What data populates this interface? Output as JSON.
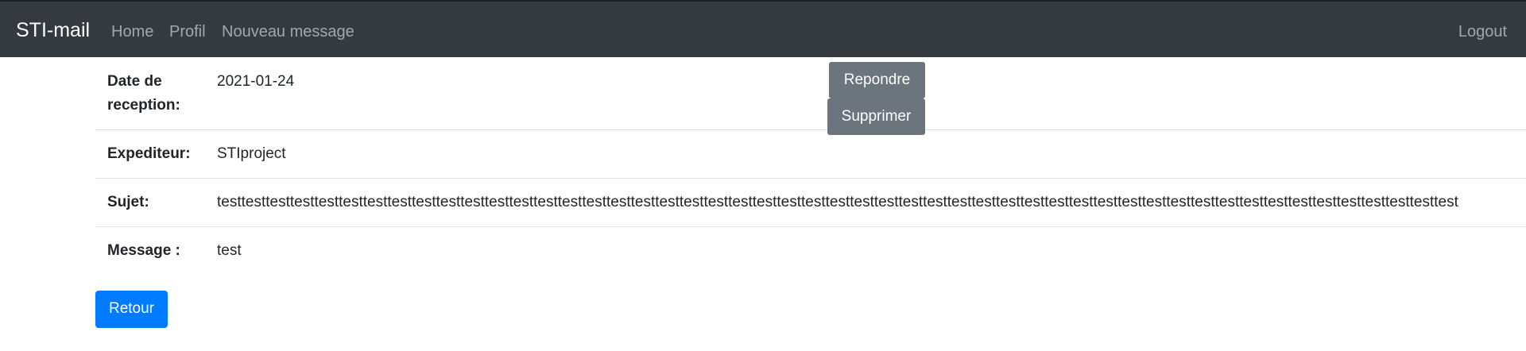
{
  "navbar": {
    "brand": "STI-mail",
    "links": [
      "Home",
      "Profil",
      "Nouveau message"
    ],
    "logout": "Logout"
  },
  "actions": {
    "reply": "Repondre",
    "delete": "Supprimer",
    "back": "Retour"
  },
  "message": {
    "date_label_line1": "Date de",
    "date_label_line2": "reception:",
    "date_value": "2021-01-24",
    "sender_label": "Expediteur:",
    "sender_value": "STIproject",
    "subject_label": "Sujet:",
    "subject_value": "testtesttesttesttesttesttesttesttesttesttesttesttesttesttesttesttesttesttesttesttesttesttesttesttesttesttesttesttesttesttesttesttesttesttesttesttesttesttesttesttesttesttesttesttesttesttesttesttesttesttest",
    "message_label": "Message :",
    "message_value": "test"
  }
}
